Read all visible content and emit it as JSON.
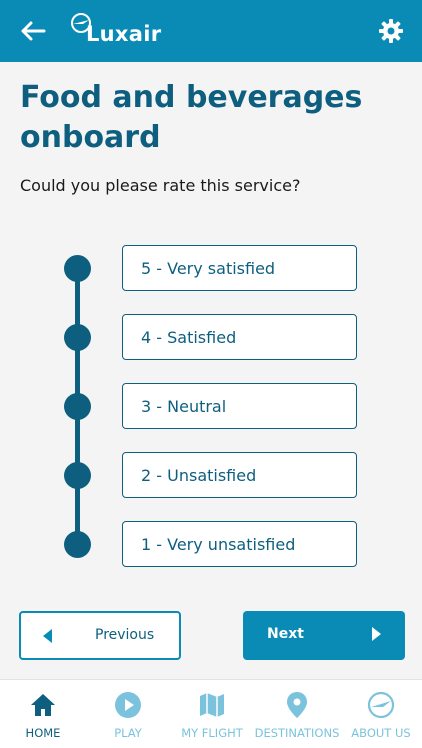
{
  "header": {
    "brand": "Luxair",
    "back_icon": "arrow-left-icon",
    "settings_icon": "gear-icon",
    "background_color": "#0a8bb5"
  },
  "page": {
    "title": "Food and beverages onboard",
    "question": "Could you please rate this service?"
  },
  "rating": {
    "options": [
      {
        "label": "5 - Very satisfied"
      },
      {
        "label": "4 - Satisfied"
      },
      {
        "label": "3 - Neutral"
      },
      {
        "label": "2 - Unsatisfied"
      },
      {
        "label": "1 - Very unsatisfied"
      }
    ],
    "accent_color": "#0e5f7f"
  },
  "actions": {
    "previous_label": "Previous",
    "next_label": "Next"
  },
  "nav": {
    "items": [
      {
        "label": "HOME",
        "icon": "home-icon",
        "active": true
      },
      {
        "label": "PLAY",
        "icon": "play-icon",
        "active": false
      },
      {
        "label": "MY FLIGHT",
        "icon": "map-icon",
        "active": false
      },
      {
        "label": "DESTINATIONS",
        "icon": "location-pin-icon",
        "active": false
      },
      {
        "label": "ABOUT US",
        "icon": "luxair-logo-icon",
        "active": false
      }
    ],
    "active_color": "#0e5f7f",
    "inactive_color": "#7bc3dc"
  }
}
